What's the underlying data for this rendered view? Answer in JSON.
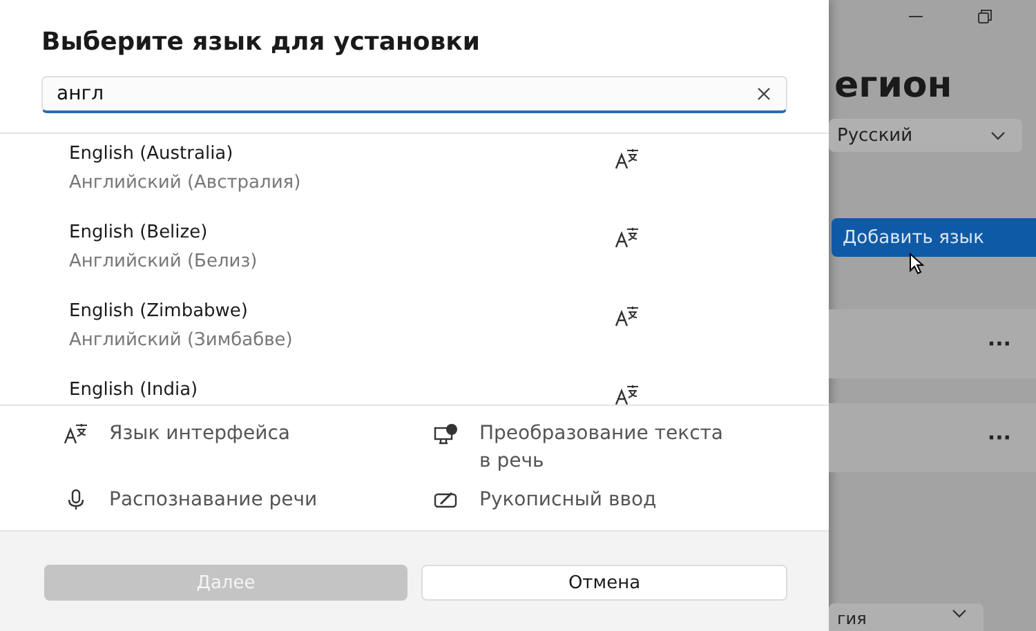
{
  "dialog": {
    "title": "Выберите язык для установки",
    "search": {
      "value": "англ"
    },
    "languages": [
      {
        "name": "English (Australia)",
        "native": "Английский (Австралия)",
        "display_language": true
      },
      {
        "name": "English (Belize)",
        "native": "Английский (Белиз)",
        "display_language": true
      },
      {
        "name": "English (Zimbabwe)",
        "native": "Английский (Зимбабве)",
        "display_language": true
      },
      {
        "name": "English (India)",
        "display_language": true
      }
    ],
    "features": [
      {
        "kind": "display",
        "label": "Язык интерфейса"
      },
      {
        "kind": "tts",
        "label": "Преобразование текста в речь"
      },
      {
        "kind": "speech",
        "label": "Распознавание речи"
      },
      {
        "kind": "handwriting",
        "label": "Рукописный ввод"
      }
    ],
    "buttons": [
      {
        "label": "Далее",
        "disabled": true
      },
      {
        "label": "Отмена",
        "disabled": false
      }
    ]
  },
  "background": {
    "heading": "егион",
    "language_dropdown": "Русский",
    "add_button": "Добавить язык",
    "more_buttons": [
      "···",
      "···"
    ],
    "bottom_dropdown": "гия"
  }
}
